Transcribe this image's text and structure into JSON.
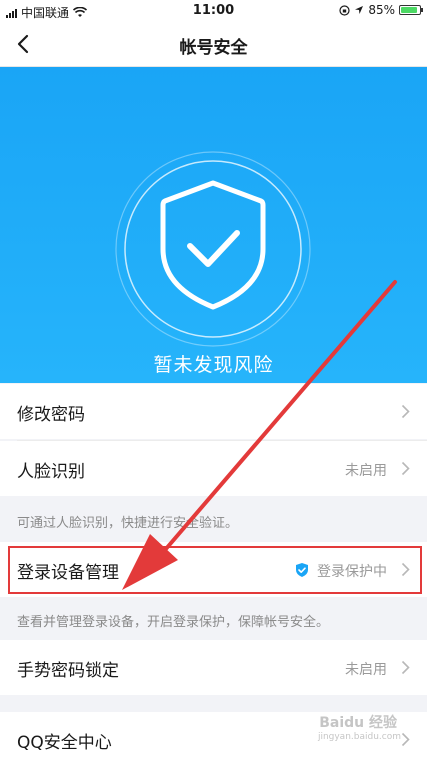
{
  "status_bar": {
    "carrier": "中国联通",
    "time": "11:00",
    "battery_percent": "85%"
  },
  "nav": {
    "title": "帐号安全"
  },
  "hero": {
    "status_text": "暂未发现风险",
    "colors": {
      "top": "#1aa5f6",
      "bottom": "#26b4fb"
    }
  },
  "settings": {
    "change_password": {
      "label": "修改密码"
    },
    "face_recognition": {
      "label": "人脸识别",
      "value": "未启用"
    },
    "face_hint": "可通过人脸识别，快捷进行安全验证。",
    "device_management": {
      "label": "登录设备管理",
      "value": "登录保护中"
    },
    "device_hint": "查看并管理登录设备，开启登录保护，保障帐号安全。",
    "gesture_lock": {
      "label": "手势密码锁定",
      "value": "未启用"
    },
    "qq_security": {
      "label": "QQ安全中心"
    }
  },
  "annotation": {
    "highlight_color": "#e33a3a"
  },
  "watermark": {
    "brand": "Baidu 经验",
    "url": "jingyan.baidu.com"
  }
}
